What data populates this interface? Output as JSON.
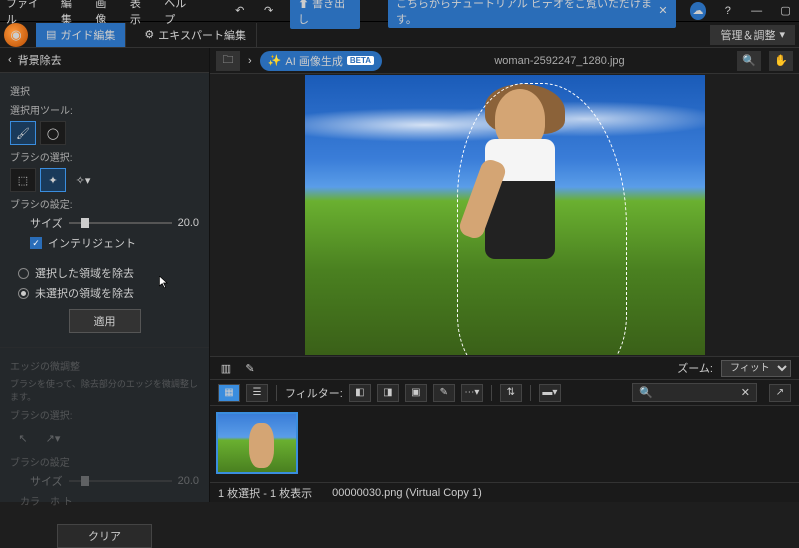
{
  "menu": {
    "file": "ファイル",
    "edit": "編集",
    "image": "画像",
    "view": "表示",
    "help": "ヘルプ",
    "export": "書き出し"
  },
  "banner": {
    "text": "こちらからチュートリアル ビデオをご覧いただけます。"
  },
  "modebar": {
    "guided": "ガイド編集",
    "expert": "エキスパート編集",
    "manage": "管理＆調整"
  },
  "sidebar": {
    "title": "背景除去",
    "select": "選択",
    "selecttool": "選択用ツール:",
    "brushsel": "ブラシの選択:",
    "brushset": "ブラシの設定:",
    "size": "サイズ",
    "sizeval": "20.0",
    "intel": "インテリジェント",
    "opt1": "選択した領域を除去",
    "opt2": "未選択の領域を除去",
    "apply": "適用",
    "edge_hdr": "エッジの微調整",
    "edge_desc": "ブラシを使って、除去部分のエッジを微調整します。",
    "brushsel2": "ブラシの選択:",
    "brushset2": "ブラシの設定",
    "size2": "サイズ",
    "sizeval2": "20.0",
    "color": "カラ　ホ ト",
    "clear": "クリア"
  },
  "filebar": {
    "ai": "AI 画像生成",
    "beta": "BETA",
    "filename": "woman-2592247_1280.jpg"
  },
  "midbar": {
    "zoom": "ズーム:",
    "fit": "フィット"
  },
  "filterbar": {
    "filter": "フィルター:"
  },
  "status": {
    "sel": "1 枚選択 - 1 枚表示",
    "file": "00000030.png (Virtual Copy 1)"
  }
}
